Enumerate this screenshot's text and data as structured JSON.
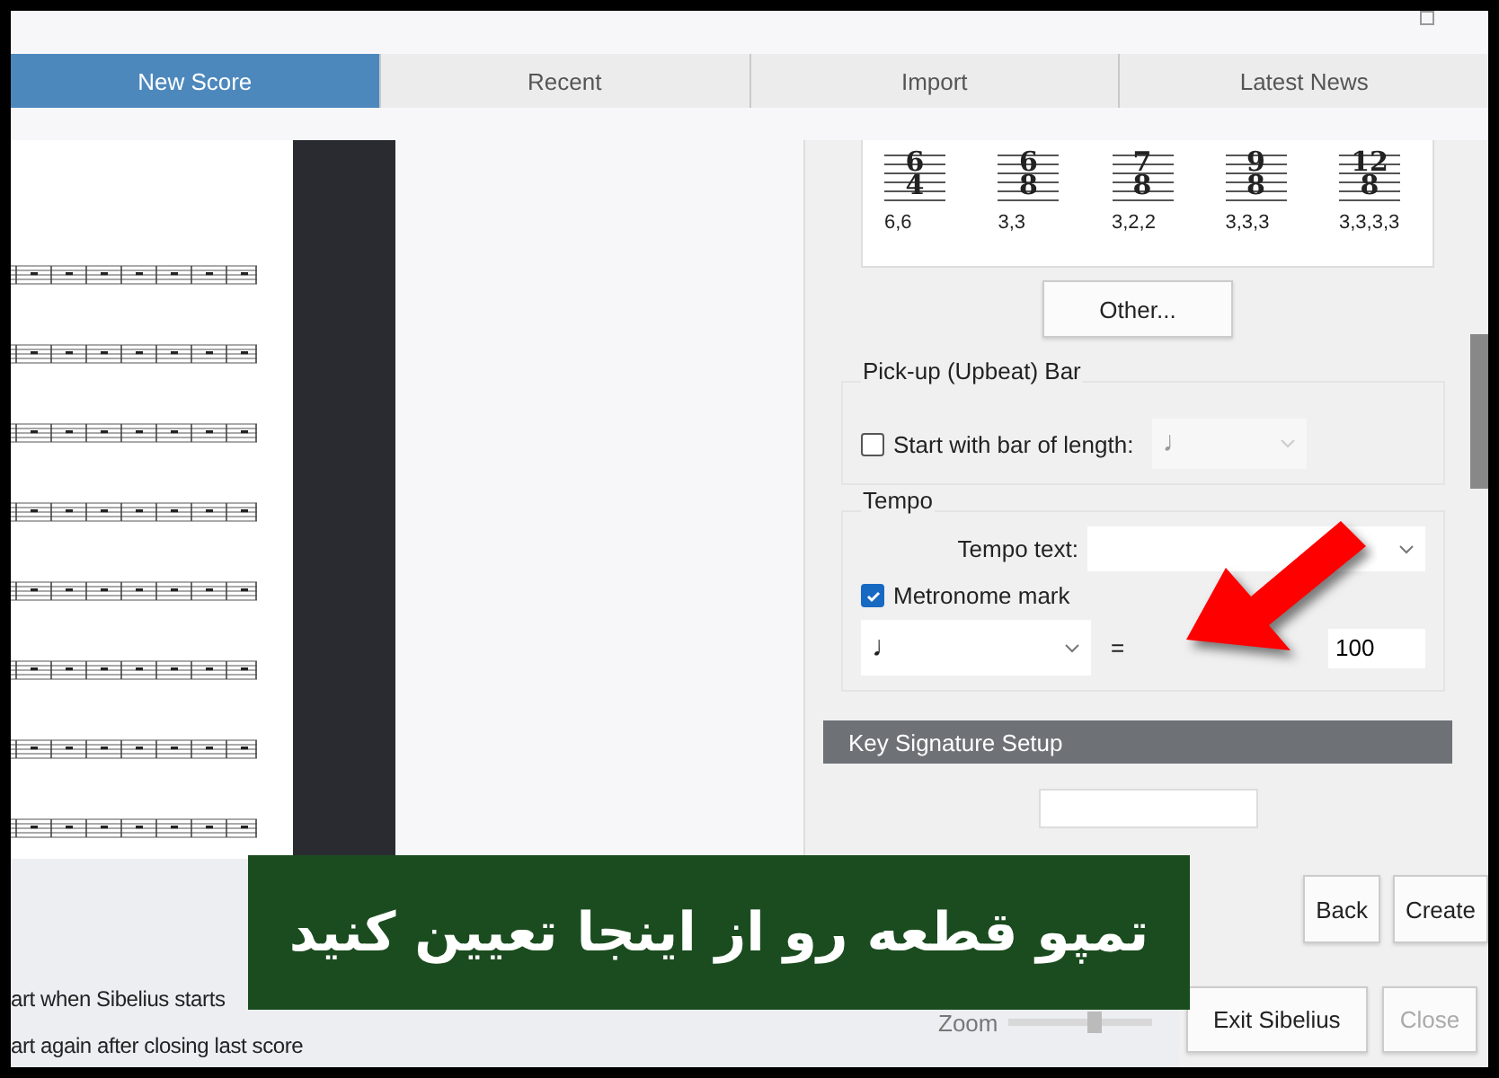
{
  "tabs": [
    {
      "label": "New Score",
      "selected": true
    },
    {
      "label": "Recent",
      "selected": false
    },
    {
      "label": "Import",
      "selected": false
    },
    {
      "label": "Latest News",
      "selected": false
    }
  ],
  "time_signatures": [
    {
      "numerator": "6",
      "denominator": "4",
      "grouping": "6,6"
    },
    {
      "numerator": "6",
      "denominator": "8",
      "grouping": "3,3"
    },
    {
      "numerator": "7",
      "denominator": "8",
      "grouping": "3,2,2"
    },
    {
      "numerator": "9",
      "denominator": "8",
      "grouping": "3,3,3"
    },
    {
      "numerator": "12",
      "denominator": "8",
      "grouping": "3,3,3,3"
    }
  ],
  "other_button": "Other...",
  "pickup": {
    "title": "Pick-up (Upbeat) Bar",
    "label": "Start with bar of length:",
    "checked": false,
    "note": "♩",
    "disabled": true
  },
  "tempo": {
    "title": "Tempo",
    "tempo_text_label": "Tempo text:",
    "metronome_label": "Metronome mark",
    "metronome_checked": true,
    "note": "♩",
    "equals": "=",
    "bpm": "100"
  },
  "key_signature": {
    "title": "Key Signature Setup"
  },
  "startup_options": [
    "art when Sibelius starts",
    "art again after closing last score"
  ],
  "zoom": {
    "label": "Zoom",
    "level": 0.55
  },
  "nav_buttons": [
    {
      "label": "Back",
      "disabled": false
    },
    {
      "label": "Create",
      "disabled": false
    }
  ],
  "bottom_buttons": [
    {
      "label": "Exit Sibelius",
      "disabled": false
    },
    {
      "label": "Close",
      "disabled": true
    }
  ],
  "banner": {
    "text": "تمپو قطعه رو از اینجا تعیین کنید"
  }
}
